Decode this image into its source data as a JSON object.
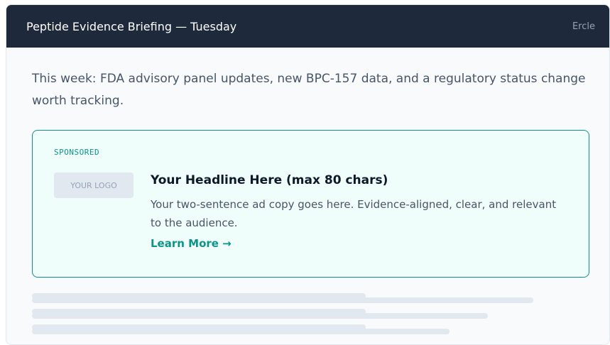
{
  "header": {
    "title": "Peptide Evidence Briefing — Tuesday",
    "brand": "Ercle"
  },
  "intro": "This week: FDA advisory panel updates, new BPC-157 data, and a regulatory status change worth tracking.",
  "ad": {
    "label": "SPONSORED",
    "logo_placeholder": "YOUR LOGO",
    "headline": "Your Headline Here (max 80 chars)",
    "copy": "Your two-sentence ad copy goes here. Evidence-aligned, clear, and relevant to the audience.",
    "cta": "Learn More →"
  },
  "colors": {
    "header_bg": "#1e293b",
    "accent": "#0d9488",
    "ad_bg": "#effdfb",
    "placeholder": "#e2e8f0"
  }
}
